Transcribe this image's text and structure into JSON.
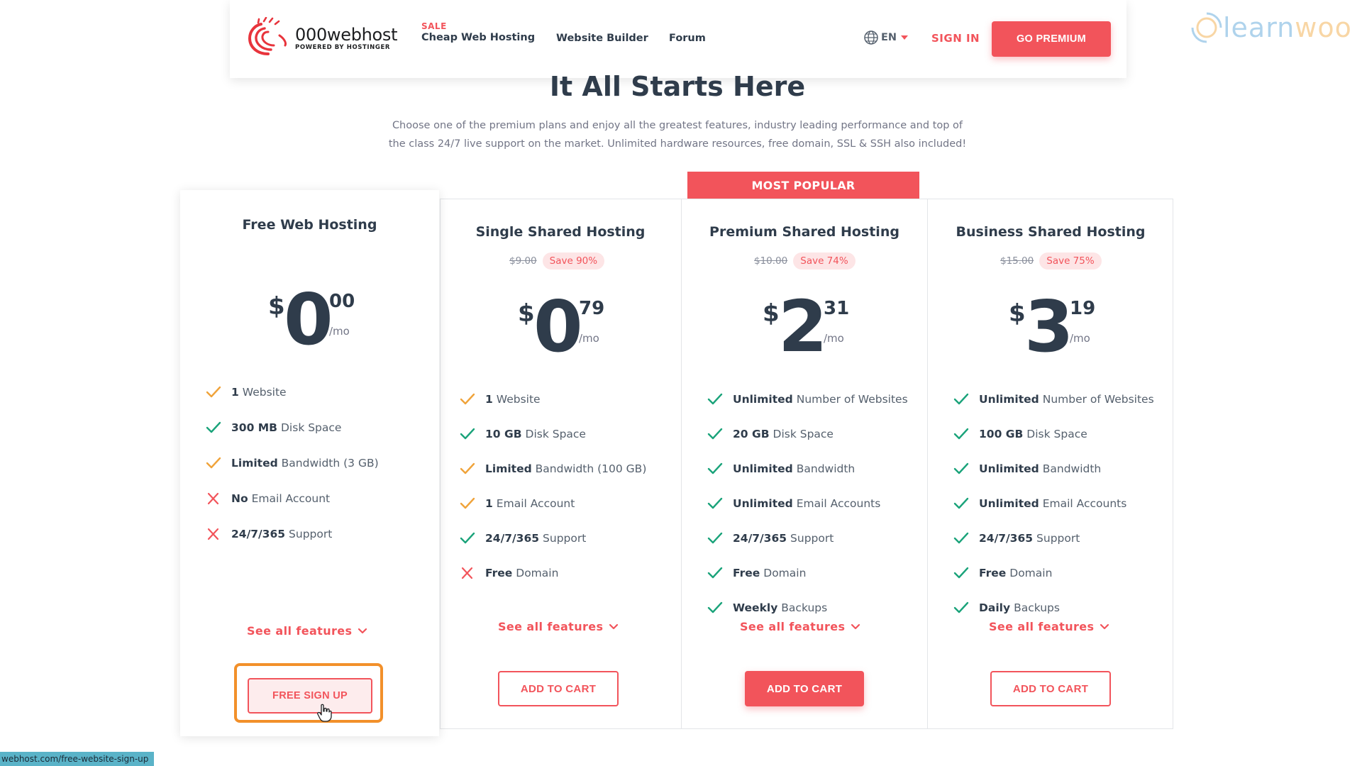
{
  "header": {
    "logo_name": "000webhost",
    "logo_sub": "POWERED BY HOSTINGER",
    "nav": {
      "sale_tag": "SALE",
      "cheap": "Cheap Web Hosting",
      "builder": "Website Builder",
      "forum": "Forum"
    },
    "lang": "EN",
    "signin": "SIGN IN",
    "go_premium": "GO PREMIUM"
  },
  "watermark": {
    "part1": "learn",
    "part2": "woo"
  },
  "hero": {
    "title": "It All Starts Here",
    "subtitle": "Choose one of the premium plans and enjoy all the greatest features, industry leading performance and top of the class 24/7 live support on the market. Unlimited hardware resources, free domain, SSL & SSH also included!"
  },
  "popular_badge": "MOST POPULAR",
  "per_month": "/mo",
  "currency": "$",
  "see_all": "See all features",
  "colors": {
    "accent": "#f2545b",
    "check_green": "#1aa37a",
    "check_orange": "#f0a33a",
    "cross_red": "#f2545b"
  },
  "plans": [
    {
      "title": "Free Web Hosting",
      "price_int": "0",
      "price_dec": "00",
      "button": "FREE SIGN UP",
      "features": [
        {
          "icon": "orange-check-icon",
          "strong": "1",
          "text": "Website"
        },
        {
          "icon": "green-check-icon",
          "strong": "300 MB",
          "text": "Disk Space"
        },
        {
          "icon": "orange-check-icon",
          "strong": "Limited",
          "text": "Bandwidth (3 GB)"
        },
        {
          "icon": "red-cross-icon",
          "strong": "No",
          "text": "Email Account"
        },
        {
          "icon": "red-cross-icon",
          "strong": "24/7/365",
          "text": "Support"
        }
      ]
    },
    {
      "title": "Single Shared Hosting",
      "old_price": "$9.00",
      "save": "Save 90%",
      "price_int": "0",
      "price_dec": "79",
      "button": "ADD TO CART",
      "features": [
        {
          "icon": "orange-check-icon",
          "strong": "1",
          "text": "Website"
        },
        {
          "icon": "green-check-icon",
          "strong": "10 GB",
          "text": "Disk Space"
        },
        {
          "icon": "orange-check-icon",
          "strong": "Limited",
          "text": "Bandwidth (100 GB)"
        },
        {
          "icon": "orange-check-icon",
          "strong": "1",
          "text": "Email Account"
        },
        {
          "icon": "green-check-icon",
          "strong": "24/7/365",
          "text": "Support"
        },
        {
          "icon": "red-cross-icon",
          "strong": "Free",
          "text": "Domain"
        }
      ]
    },
    {
      "title": "Premium Shared Hosting",
      "old_price": "$10.00",
      "save": "Save 74%",
      "price_int": "2",
      "price_dec": "31",
      "button": "ADD TO CART",
      "features": [
        {
          "icon": "green-check-icon",
          "strong": "Unlimited",
          "text": "Number of Websites"
        },
        {
          "icon": "green-check-icon",
          "strong": "20 GB",
          "text": "Disk Space"
        },
        {
          "icon": "green-check-icon",
          "strong": "Unlimited",
          "text": "Bandwidth"
        },
        {
          "icon": "green-check-icon",
          "strong": "Unlimited",
          "text": "Email Accounts"
        },
        {
          "icon": "green-check-icon",
          "strong": "24/7/365",
          "text": "Support"
        },
        {
          "icon": "green-check-icon",
          "strong": "Free",
          "text": "Domain"
        },
        {
          "icon": "green-check-icon",
          "strong": "Weekly",
          "text": "Backups"
        }
      ]
    },
    {
      "title": "Business Shared Hosting",
      "old_price": "$15.00",
      "save": "Save 75%",
      "price_int": "3",
      "price_dec": "19",
      "button": "ADD TO CART",
      "features": [
        {
          "icon": "green-check-icon",
          "strong": "Unlimited",
          "text": "Number of Websites"
        },
        {
          "icon": "green-check-icon",
          "strong": "100 GB",
          "text": "Disk Space"
        },
        {
          "icon": "green-check-icon",
          "strong": "Unlimited",
          "text": "Bandwidth"
        },
        {
          "icon": "green-check-icon",
          "strong": "Unlimited",
          "text": "Email Accounts"
        },
        {
          "icon": "green-check-icon",
          "strong": "24/7/365",
          "text": "Support"
        },
        {
          "icon": "green-check-icon",
          "strong": "Free",
          "text": "Domain"
        },
        {
          "icon": "green-check-icon",
          "strong": "Daily",
          "text": "Backups"
        }
      ]
    }
  ],
  "status_url": "webhost.com/free-website-sign-up"
}
